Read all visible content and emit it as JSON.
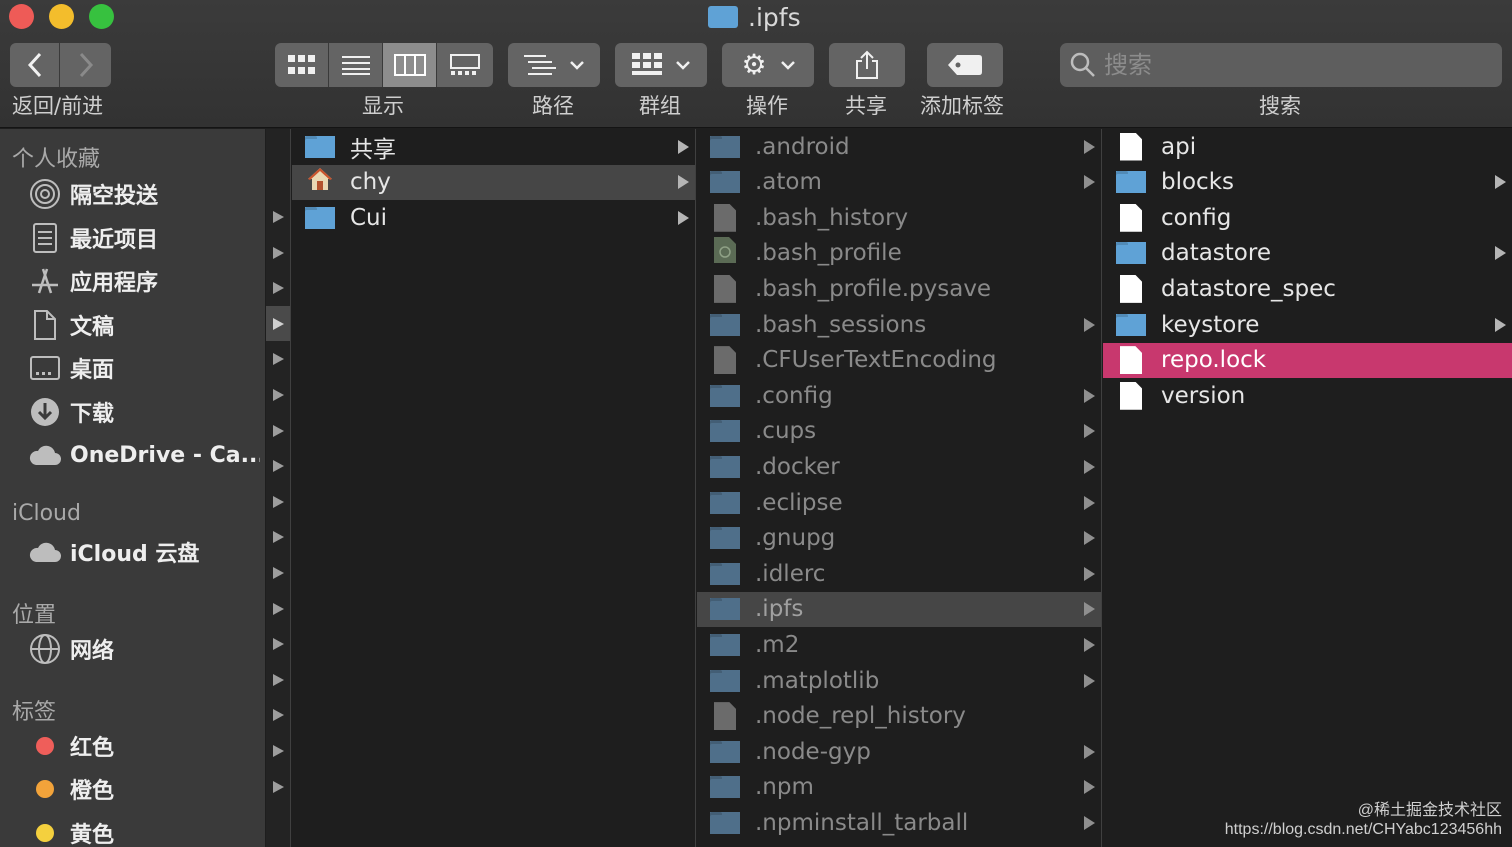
{
  "window": {
    "title": ".ipfs"
  },
  "toolbar": {
    "back_forward_label": "返回/前进",
    "view_label": "显示",
    "path_label": "路径",
    "group_label": "群组",
    "action_label": "操作",
    "share_label": "共享",
    "tags_label": "添加标签",
    "search_label": "搜索",
    "search_placeholder": "搜索",
    "view_selected": "column"
  },
  "sidebar": {
    "favorites_header": "个人收藏",
    "favorites": [
      {
        "label": "隔空投送",
        "icon": "airdrop-icon"
      },
      {
        "label": "最近项目",
        "icon": "recents-icon"
      },
      {
        "label": "应用程序",
        "icon": "applications-icon"
      },
      {
        "label": "文稿",
        "icon": "documents-icon"
      },
      {
        "label": "桌面",
        "icon": "desktop-icon"
      },
      {
        "label": "下载",
        "icon": "downloads-icon"
      },
      {
        "label": "OneDrive - Ca...",
        "icon": "cloud-icon"
      }
    ],
    "icloud_header": "iCloud",
    "icloud": [
      {
        "label": "iCloud 云盘",
        "icon": "cloud-icon"
      }
    ],
    "locations_header": "位置",
    "locations": [
      {
        "label": "网络",
        "icon": "network-icon"
      }
    ],
    "tags_header": "标签",
    "tags": [
      {
        "label": "红色",
        "color": "#ef5e5a"
      },
      {
        "label": "橙色",
        "color": "#f2a33a"
      },
      {
        "label": "黄色",
        "color": "#f4d03e"
      }
    ]
  },
  "columns": [
    {
      "items": [
        {
          "name": "共享",
          "type": "folder",
          "expand": true
        },
        {
          "name": "chy",
          "type": "home",
          "expand": true,
          "selected": true
        },
        {
          "name": "Cui",
          "type": "folder",
          "expand": true
        }
      ]
    },
    {
      "items": [
        {
          "name": ".android",
          "type": "folder",
          "expand": true
        },
        {
          "name": ".atom",
          "type": "folder",
          "expand": true
        },
        {
          "name": ".bash_history",
          "type": "file",
          "expand": false
        },
        {
          "name": ".bash_profile",
          "type": "script",
          "expand": false
        },
        {
          "name": ".bash_profile.pysave",
          "type": "file",
          "expand": false
        },
        {
          "name": ".bash_sessions",
          "type": "folder",
          "expand": true
        },
        {
          "name": ".CFUserTextEncoding",
          "type": "file",
          "expand": false
        },
        {
          "name": ".config",
          "type": "folder",
          "expand": true
        },
        {
          "name": ".cups",
          "type": "folder",
          "expand": true
        },
        {
          "name": ".docker",
          "type": "folder",
          "expand": true
        },
        {
          "name": ".eclipse",
          "type": "folder",
          "expand": true
        },
        {
          "name": ".gnupg",
          "type": "folder",
          "expand": true
        },
        {
          "name": ".idlerc",
          "type": "folder",
          "expand": true
        },
        {
          "name": ".ipfs",
          "type": "folder",
          "expand": true,
          "selected": true
        },
        {
          "name": ".m2",
          "type": "folder",
          "expand": true
        },
        {
          "name": ".matplotlib",
          "type": "folder",
          "expand": true
        },
        {
          "name": ".node_repl_history",
          "type": "file",
          "expand": false
        },
        {
          "name": ".node-gyp",
          "type": "folder",
          "expand": true
        },
        {
          "name": ".npm",
          "type": "folder",
          "expand": true
        },
        {
          "name": ".npminstall_tarball",
          "type": "folder",
          "expand": true
        }
      ]
    },
    {
      "items": [
        {
          "name": "api",
          "type": "file",
          "expand": false
        },
        {
          "name": "blocks",
          "type": "folder",
          "expand": true
        },
        {
          "name": "config",
          "type": "file",
          "expand": false
        },
        {
          "name": "datastore",
          "type": "folder",
          "expand": true
        },
        {
          "name": "datastore_spec",
          "type": "file",
          "expand": false
        },
        {
          "name": "keystore",
          "type": "folder",
          "expand": true
        },
        {
          "name": "repo.lock",
          "type": "file",
          "expand": false,
          "selected": true
        },
        {
          "name": "version",
          "type": "file",
          "expand": false
        }
      ]
    }
  ],
  "colors": {
    "folder": "#5fa2d6",
    "folder_dim": "#4f6f8a",
    "highlight": "#c8386e",
    "selection_gray": "#464646"
  },
  "watermark": {
    "line1": "@稀土掘金技术社区",
    "line2": "https://blog.csdn.net/CHYabc123456hh"
  }
}
